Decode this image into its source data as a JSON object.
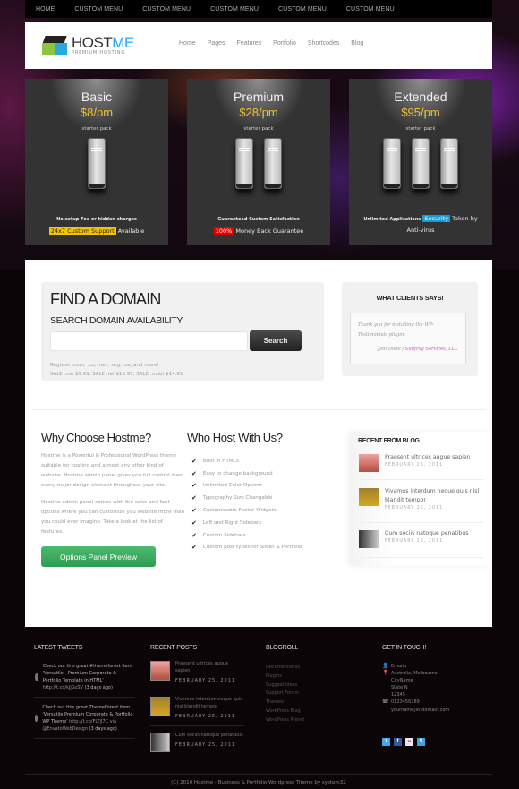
{
  "topbar": {
    "items": [
      "HOME",
      "CUSTOM MENU",
      "CUSTOM MENU",
      "CUSTOM MENU",
      "CUSTOM MENU",
      "CUSTOM MENU"
    ]
  },
  "header": {
    "logo_main": "HOST",
    "logo_accent": "ME",
    "logo_tagline": "PREMIUM HOSTING",
    "nav": [
      "Home",
      "Pages",
      "Features",
      "Portfolio",
      "Shortcodes",
      "Blog"
    ]
  },
  "plans": [
    {
      "name": "Basic",
      "price": "$8/pm",
      "sub": "starter pack",
      "servers": 1,
      "note": "No setup Fee or hidden charges",
      "highlight": "24x7 Custom Support",
      "highlight_color": "#f5c400",
      "rest": " Available"
    },
    {
      "name": "Premium",
      "price": "$28/pm",
      "sub": "starter pack",
      "servers": 2,
      "note": "Guaranteed Custom Satisfaction",
      "highlight": "100%",
      "highlight_color": "#e50000",
      "rest": " Money Back Guarantee"
    },
    {
      "name": "Extended",
      "price": "$95/pm",
      "sub": "starter pack",
      "servers": 3,
      "note": "Unlimited Applications",
      "highlight": "Security",
      "highlight_color": "#1a9ad6",
      "rest": " Taken by Anti-virus"
    }
  ],
  "domain": {
    "title": "FIND A DOMAIN",
    "subtitle": "SEARCH DOMAIN AVAILABILITY",
    "input_value": "",
    "search_label": "Search",
    "info_line1": "Register .com, .co, .net, .org, .us, and more!",
    "info_line2": "SALE .me $5.95, SALE .tel $10.95, SALE .mobi $14.95"
  },
  "clients": {
    "title": "WHAT CLIENTS SAYS!",
    "quote": "Thank you for installing the WP-Testimonials plugin.",
    "author": "Jodi Diehl / ",
    "company": "Sunfrog Services, LLC"
  },
  "why": {
    "title": "Why Choose Hostme?",
    "p1": "Hostme is a Powerful & Professional WordPress theme suitable for hosting and almost any other kind of website. Hostme admin panel gives you full control over every major design element throughout your site.",
    "p2": "Hostme admin panel comes with the color and font options where you can customize you website more than you could ever imagine. Take a look at the list of features.",
    "button": "Options Panel Preview"
  },
  "who": {
    "title": "Who Host With Us?",
    "features": [
      "Built in HTML5",
      "Easy to change background",
      "Unlimited Color Optionr",
      "Typography Size Changable",
      "Customizable Footer Widgets",
      "Left and Right Sidebars",
      "Custom Sidebars",
      "Custom post types for Slider & Portfolio"
    ]
  },
  "blog": {
    "title": "RECENT FROM BLOG",
    "posts": [
      {
        "title": "Praesent ultrices augue sapien",
        "date": "FEBRUARY 25, 2011"
      },
      {
        "title": "Vivamus interdum neque quis nisl blandit tempor",
        "date": "FEBRUARY 25, 2011"
      },
      {
        "title": "Cum sociis natoque penatibus",
        "date": "FEBRUARY 25, 2011"
      }
    ]
  },
  "footer": {
    "tweets_title": "LATEST TWEETS",
    "tweets": [
      {
        "text": "Check out this great #themeforest item 'Versatile - Premium Corporate & Portfolio Template in HTML' ",
        "link": "http://t.co/kjjGcSV",
        "ago": "(3 days ago)"
      },
      {
        "text": "Check out this great ThemeForest item 'Versatile Premium Corporate & Portfolio WP Theme' ",
        "link": "http://t.co/FLTjI7C via @EnvatoWebDesign",
        "ago": "(3 days ago)"
      }
    ],
    "posts_title": "RECENT POSTS",
    "posts": [
      {
        "title": "Praesent ultrices augue sapien",
        "date": "FEBRUARY 25, 2011"
      },
      {
        "title": "Vivamus interdum neque quis nisl blandit tempor",
        "date": "FEBRUARY 25, 2011"
      },
      {
        "title": "Cum sociis natoque penatibus",
        "date": "FEBRUARY 25, 2011"
      }
    ],
    "blogroll_title": "BLOGROLL",
    "blogroll": [
      "Documentation",
      "Plugins",
      "Suggest Ideas",
      "Support Forum",
      "Themes",
      "WordPress Blog",
      "WordPress Planet"
    ],
    "contact_title": "GET IN TOUCH!",
    "contact": {
      "name": "Envato",
      "address": [
        "Australia, Melbourne",
        "CityName",
        "State N",
        "12345"
      ],
      "phone": "0123456789",
      "email": "yourname[at]domain.com"
    },
    "social": [
      {
        "icon": "twitter-icon",
        "glyph": "t",
        "color": "#3fa9f5"
      },
      {
        "icon": "facebook-icon",
        "glyph": "f",
        "color": "#3b5998"
      },
      {
        "icon": "flickr-icon",
        "glyph": "••",
        "color": "#e8e8e8"
      },
      {
        "icon": "skype-icon",
        "glyph": "S",
        "color": "#3ba4e0"
      }
    ],
    "copyright": "(C) 2010 Hostme - Business & Portfolio Wordpress Theme by system32"
  }
}
